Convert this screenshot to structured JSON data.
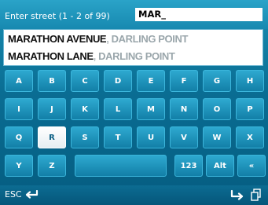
{
  "header": {
    "prompt": "Enter street (1 - 2 of 99)",
    "query": "MAR_"
  },
  "results": [
    {
      "street": "MARATHON AVENUE",
      "separator": ",",
      "suburb": " DARLING POINT"
    },
    {
      "street": "MARATHON LANE",
      "separator": ",",
      "suburb": " DARLING POINT"
    }
  ],
  "keyboard": {
    "rows": [
      [
        "A",
        "B",
        "C",
        "D",
        "E",
        "F",
        "G",
        "H"
      ],
      [
        "I",
        "J",
        "K",
        "L",
        "M",
        "N",
        "O",
        "P"
      ],
      [
        "Q",
        "R",
        "S",
        "T",
        "U",
        "V",
        "W",
        "X"
      ]
    ],
    "last_row": {
      "y": "Y",
      "z": "Z",
      "space": "",
      "num": "123",
      "alt": "Alt",
      "back": "«"
    },
    "selected_key": "R"
  },
  "footer": {
    "esc_label": "ESC",
    "esc_icon": "enter-arrow-icon",
    "forward_icon": "forward-arrow-icon",
    "pages_icon": "pages-icon"
  },
  "colors": {
    "background": "#0a6d93",
    "key": "#1a8fb8",
    "selected_key": "#ffffff",
    "suburb_text": "#9aa6ab"
  }
}
